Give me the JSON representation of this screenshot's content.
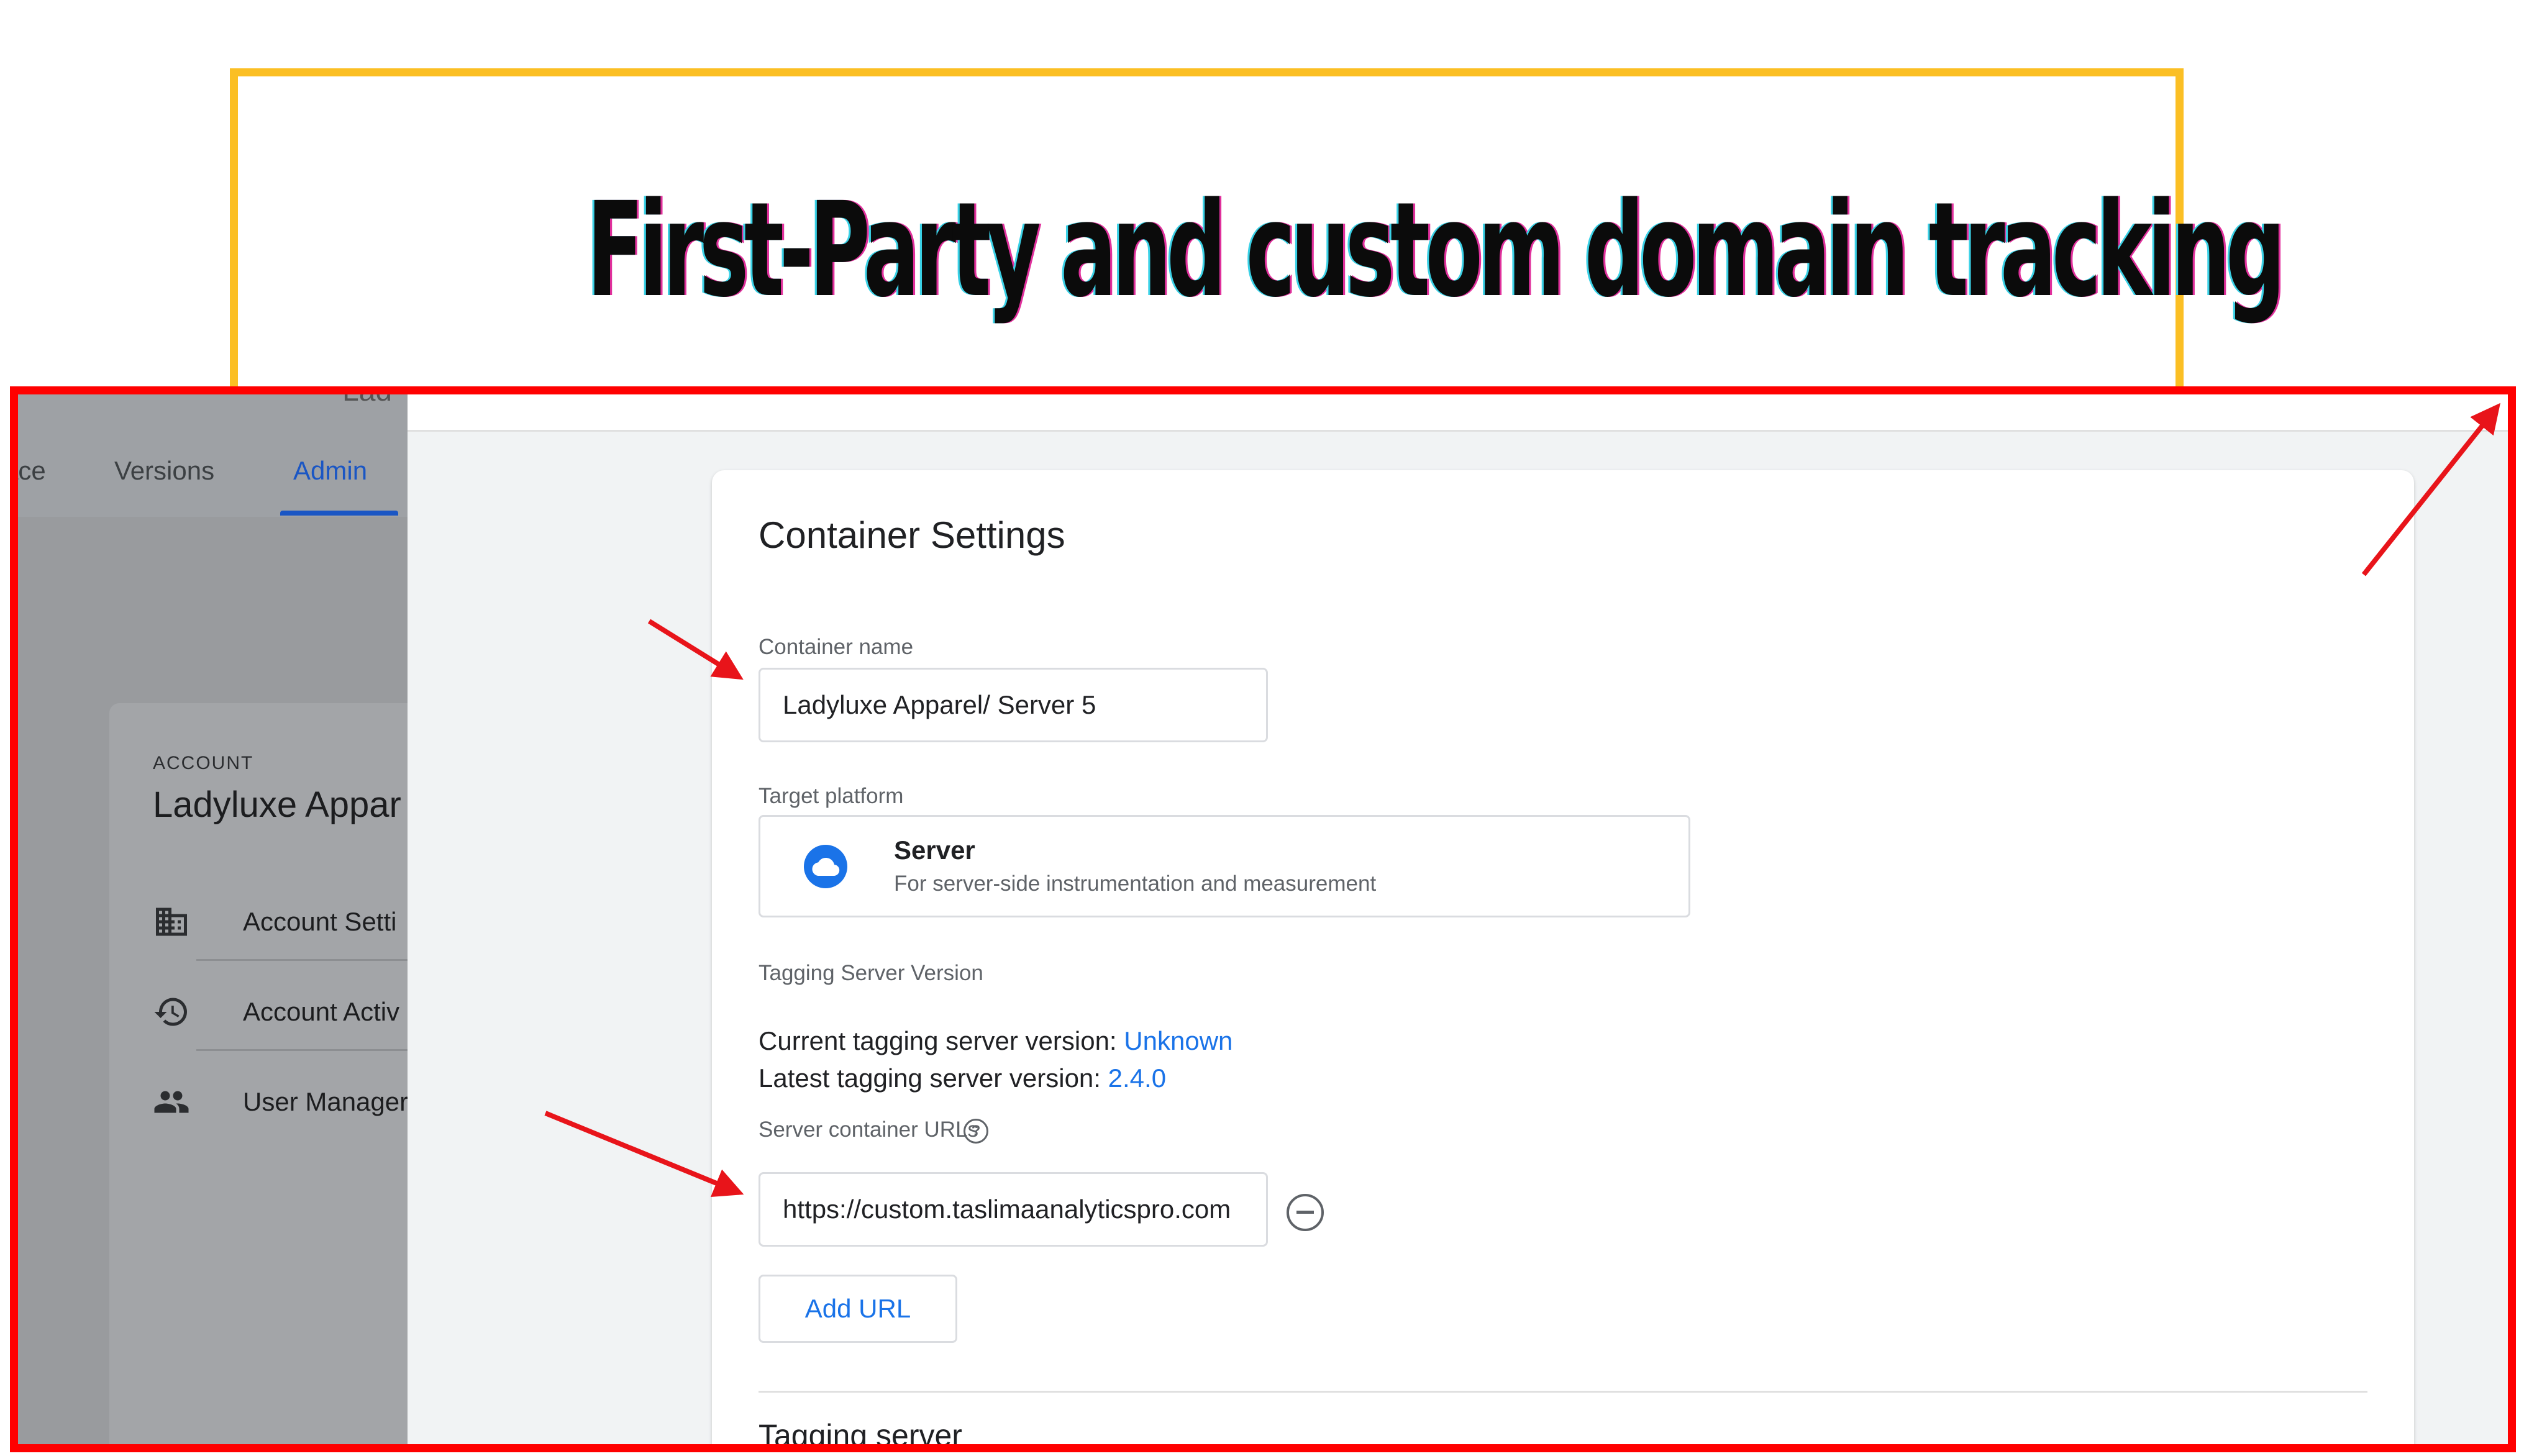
{
  "banner": {
    "title": "First-Party and custom domain tracking"
  },
  "background": {
    "tabs": [
      {
        "label": "ace"
      },
      {
        "label": "Versions"
      },
      {
        "label": "Admin"
      }
    ],
    "account_label": "ACCOUNT",
    "account_name": "Ladyluxe Appar",
    "menu": [
      {
        "label": "Account Setti",
        "icon": "building-icon"
      },
      {
        "label": "Account Activ",
        "icon": "history-icon"
      },
      {
        "label": "User Manager",
        "icon": "people-icon"
      }
    ]
  },
  "panel": {
    "title": "Container Settings",
    "container_name": {
      "label": "Container name",
      "value": "Ladyluxe Apparel/ Server 5"
    },
    "target_platform": {
      "label": "Target platform",
      "name": "Server",
      "description": "For server-side instrumentation and measurement",
      "icon": "cloud-icon"
    },
    "tagging_server_version": {
      "label": "Tagging Server Version",
      "current_prefix": "Current tagging server version:",
      "current_value": "Unknown",
      "latest_prefix": "Latest tagging server version:",
      "latest_value": "2.4.0"
    },
    "server_urls": {
      "label": "Server container URLs",
      "help_glyph": "?",
      "value": "https://custom.taslimaanalyticspro.com"
    },
    "add_url_label": "Add URL",
    "tagging_server_title": "Tagging server"
  },
  "colors": {
    "banner_border": "#fbbf24",
    "frame_border": "#ff0000",
    "arrow": "#e8141a",
    "link": "#1a73e8"
  }
}
